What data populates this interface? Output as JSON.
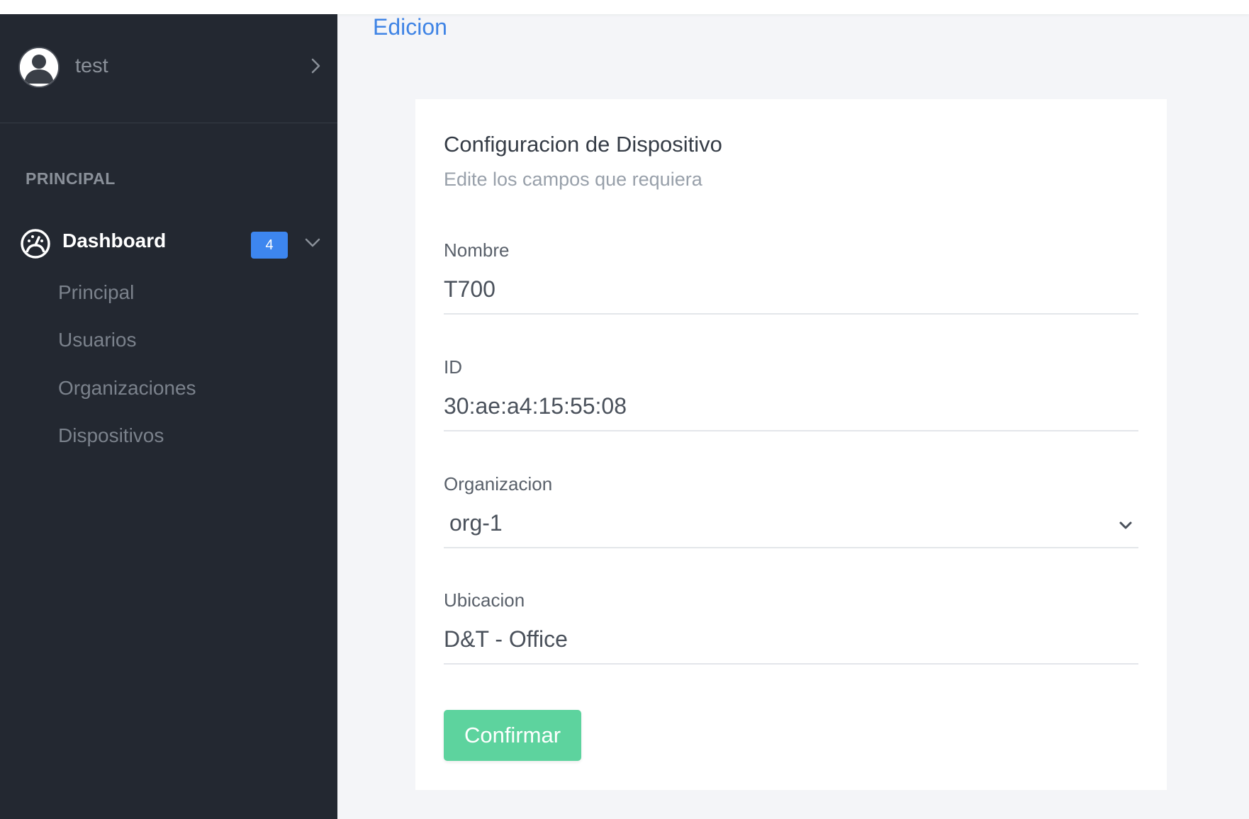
{
  "sidebar": {
    "user": {
      "name": "test",
      "avatar_icon": "user-avatar-icon",
      "chevron_icon": "chevron-right-icon"
    },
    "section_label": "PRINCIPAL",
    "dashboard": {
      "label": "Dashboard",
      "badge": "4",
      "icon": "dashboard-gauge-icon",
      "chevron_icon": "chevron-down-icon"
    },
    "items": [
      {
        "label": "Principal"
      },
      {
        "label": "Usuarios"
      },
      {
        "label": "Organizaciones"
      },
      {
        "label": "Dispositivos"
      }
    ]
  },
  "main": {
    "title": "Edicion",
    "card": {
      "title": "Configuracion de Dispositivo",
      "subtitle": "Edite los campos que requiera",
      "fields": {
        "nombre": {
          "label": "Nombre",
          "value": "T700"
        },
        "id": {
          "label": "ID",
          "value": "30:ae:a4:15:55:08"
        },
        "organizacion": {
          "label": "Organizacion",
          "value": "org-1"
        },
        "ubicacion": {
          "label": "Ubicacion",
          "value": "D&T - Office"
        }
      },
      "confirm_label": "Confirmar"
    }
  },
  "colors": {
    "sidebar_bg": "#232831",
    "page_bg": "#f4f5f8",
    "accent_blue": "#3f84e5",
    "badge_blue": "#3d86ef",
    "confirm_green": "#5dd39e"
  }
}
